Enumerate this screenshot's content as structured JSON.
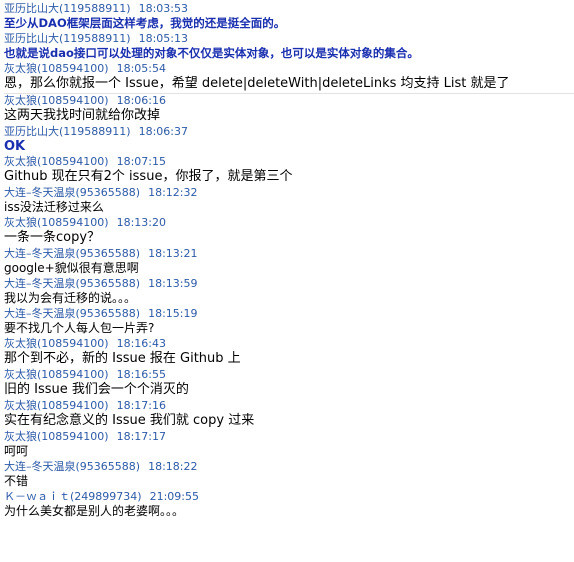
{
  "messages": [
    {
      "sender": "亚历比山大(119588911)",
      "time": "18:03:53",
      "text": "至少从DAO框架层面这样考虑，我觉的还是挺全面的。",
      "style": "blue"
    },
    {
      "sender": "亚历比山大(119588911)",
      "time": "18:05:13",
      "text": "也就是说dao接口可以处理的对象不仅仅是实体对象，也可以是实体对象的集合。",
      "style": "blue"
    },
    {
      "sender": "灰太狼(108594100)",
      "time": "18:05:54",
      "text": "恩，那么你就报一个 Issue，希望 delete|deleteWith|deleteLinks 均支持 List 就是了",
      "style": "s13"
    },
    {
      "sender": "灰太狼(108594100)",
      "time": "18:06:16",
      "text": "这两天我找时间就给你改掉",
      "style": "s13"
    },
    {
      "sender": "亚历比山大(119588911)",
      "time": "18:06:37",
      "text": "OK",
      "style": "bluebold"
    },
    {
      "sender": "灰太狼(108594100)",
      "time": "18:07:15",
      "text": "Github 现在只有2个 issue，你报了，就是第三个",
      "style": "s13"
    },
    {
      "sender": "大连–冬天温泉(95365588)",
      "time": "18:12:32",
      "text": "iss没法迁移过来么",
      "style": "s12"
    },
    {
      "sender": "灰太狼(108594100)",
      "time": "18:13:20",
      "text": "一条一条copy？",
      "style": "s13"
    },
    {
      "sender": "大连–冬天温泉(95365588)",
      "time": "18:13:21",
      "text": "google+貌似很有意思啊",
      "style": "s12"
    },
    {
      "sender": "大连–冬天温泉(95365588)",
      "time": "18:13:59",
      "text": "我以为会有迁移的说。。。",
      "style": "s12"
    },
    {
      "sender": "大连–冬天温泉(95365588)",
      "time": "18:15:19",
      "text": "要不找几个人每人包一片弄?",
      "style": "s12"
    },
    {
      "sender": "灰太狼(108594100)",
      "time": "18:16:43",
      "text": "那个到不必，新的 Issue 报在 Github 上",
      "style": "s13"
    },
    {
      "sender": "灰太狼(108594100)",
      "time": "18:16:55",
      "text": "旧的 Issue 我们会一个个消灭的",
      "style": "s13"
    },
    {
      "sender": "灰太狼(108594100)",
      "time": "18:17:16",
      "text": "实在有纪念意义的 Issue 我们就 copy 过来",
      "style": "s13"
    },
    {
      "sender": "灰太狼(108594100)",
      "time": "18:17:17",
      "text": "呵呵",
      "style": "s12"
    },
    {
      "sender": "大连–冬天温泉(95365588)",
      "time": "18:18:22",
      "text": "不错",
      "style": "s12"
    },
    {
      "sender": "Ｋ－ｗａｉｔ(249899734)",
      "time": "21:09:55",
      "text": "为什么美女都是别人的老婆啊。。。",
      "style": "s12"
    }
  ]
}
